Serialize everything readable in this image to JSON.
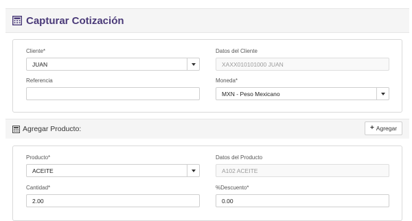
{
  "title": "Capturar Cotización",
  "cliente": {
    "label": "Cliente*",
    "value": "JUAN"
  },
  "datos_cliente": {
    "label": "Datos del Cliente",
    "value": "XAXX010101000 JUAN"
  },
  "referencia": {
    "label": "Referencia",
    "value": ""
  },
  "moneda": {
    "label": "Moneda*",
    "value": "MXN - Peso Mexicano"
  },
  "agregar_producto": {
    "title": "Agregar Producto:",
    "button_label": "Agregar"
  },
  "producto": {
    "label": "Producto*",
    "value": "ACEITE"
  },
  "datos_producto": {
    "label": "Datos del Producto",
    "value": "A102 ACEITE"
  },
  "cantidad": {
    "label": "Cantidad*",
    "value": "2.00"
  },
  "descuento": {
    "label": "%Descuento*",
    "value": "0.00"
  },
  "colors": {
    "title": "#4a3a78",
    "border": "#cfcfcf"
  }
}
